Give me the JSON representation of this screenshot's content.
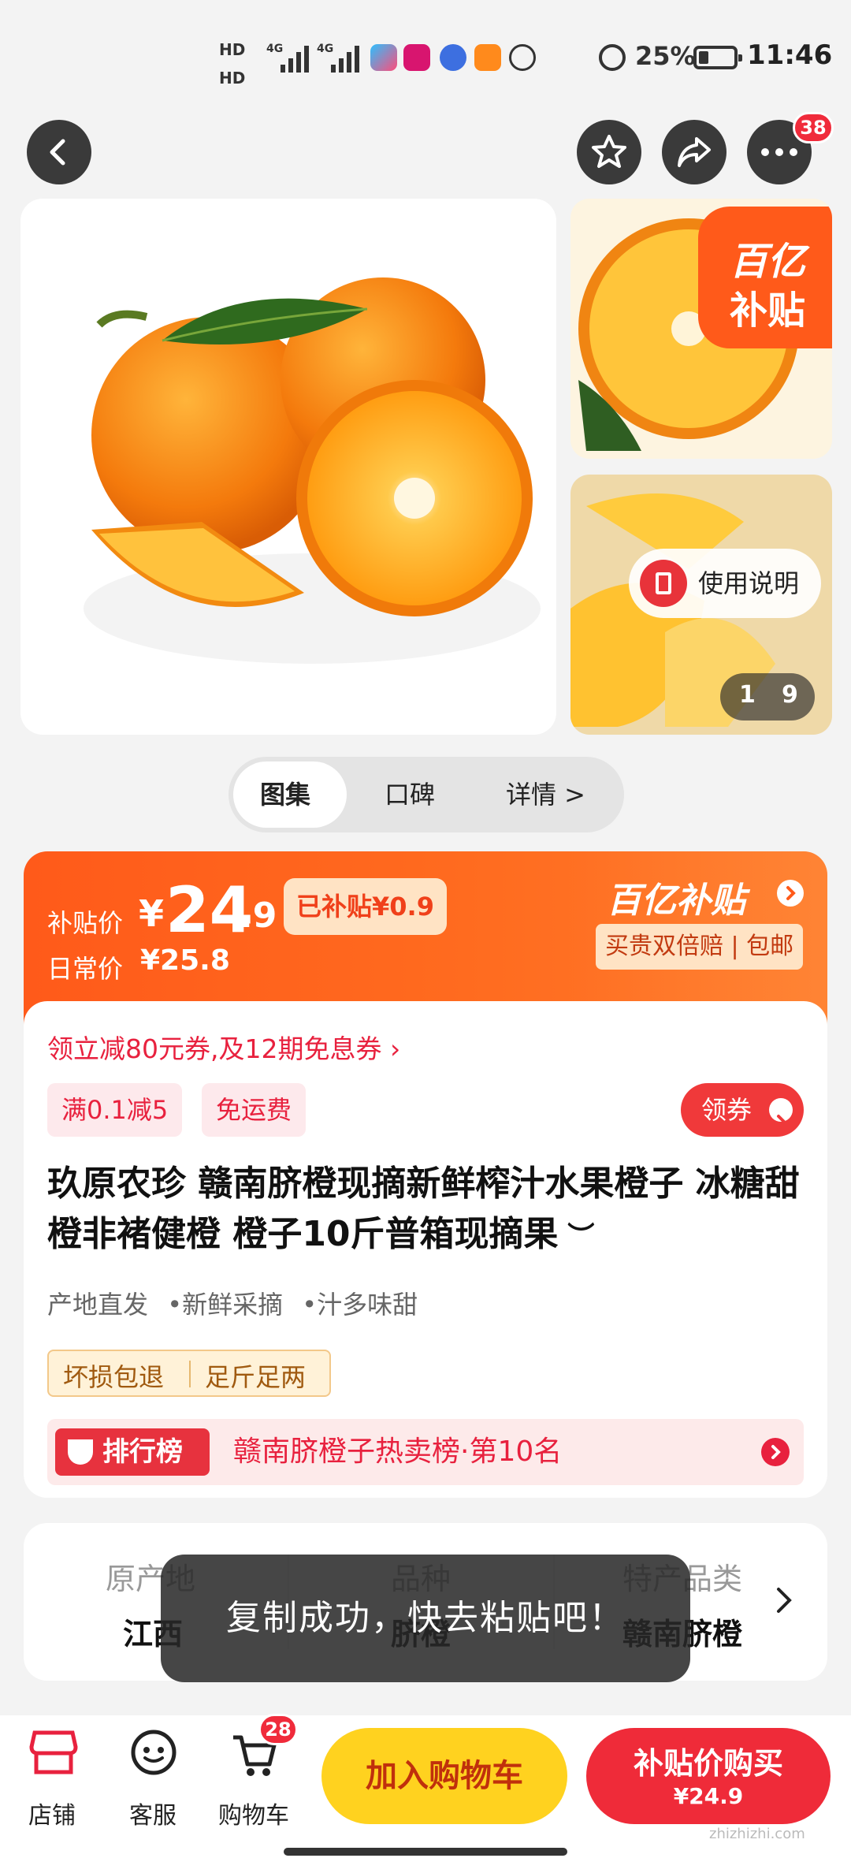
{
  "status_bar": {
    "hd1": "HD",
    "hd2": "HD",
    "net1": "4G",
    "net2": "4G",
    "battery": "25%",
    "time": "11:46"
  },
  "top_bar": {
    "more_badge": "38"
  },
  "gallery": {
    "subsidy_badge_line1": "百亿",
    "subsidy_badge_line2": "补贴",
    "usage_label": "使用说明",
    "counter_current": "1",
    "counter_total": "9"
  },
  "tabs": [
    {
      "label": "图集"
    },
    {
      "label": "口碑"
    },
    {
      "label": "详情 >"
    }
  ],
  "price": {
    "subsidy_label": "补贴价",
    "currency": "¥",
    "integer": "24",
    "decimal": ".9",
    "subsidized": "已补贴¥0.9",
    "regular_label": "日常价",
    "regular_price": "¥25.8",
    "brand_logo": "百亿补贴",
    "guarantee": "买贵双倍赔 | 包邮"
  },
  "coupon_line": "领立减80元券,及12期免息券 ›",
  "tags": [
    "满0.1减5",
    "免运费"
  ],
  "get_coupon": "领券",
  "product_title": "玖原农珍 赣南脐橙现摘新鲜榨汁水果橙子 冰糖甜橙非褚健橙 橙子10斤普箱现摘果",
  "features": [
    "产地直发",
    "新鲜采摘",
    "汁多味甜"
  ],
  "service_tags": [
    "坏损包退",
    "足斤足两"
  ],
  "ranking": {
    "badge": "排行榜",
    "text": "赣南脐橙子热卖榜·第10名"
  },
  "specs": [
    {
      "label": "原产地",
      "value": "江西"
    },
    {
      "label": "品种",
      "value": "脐橙"
    },
    {
      "label": "特产品类",
      "value": "赣南脐橙"
    }
  ],
  "toast": "复制成功，快去粘贴吧！",
  "bottom_bar": {
    "store": "店铺",
    "service": "客服",
    "cart": "购物车",
    "cart_badge": "28",
    "add_to_cart": "加入购物车",
    "buy_label": "补贴价购买",
    "buy_price": "¥24.9"
  },
  "watermark_text": "zhizhizhi.com",
  "colors": {
    "accent_orange": "#ff5a1a",
    "accent_red": "#ef2b39",
    "cart_yellow": "#ffd21f"
  }
}
